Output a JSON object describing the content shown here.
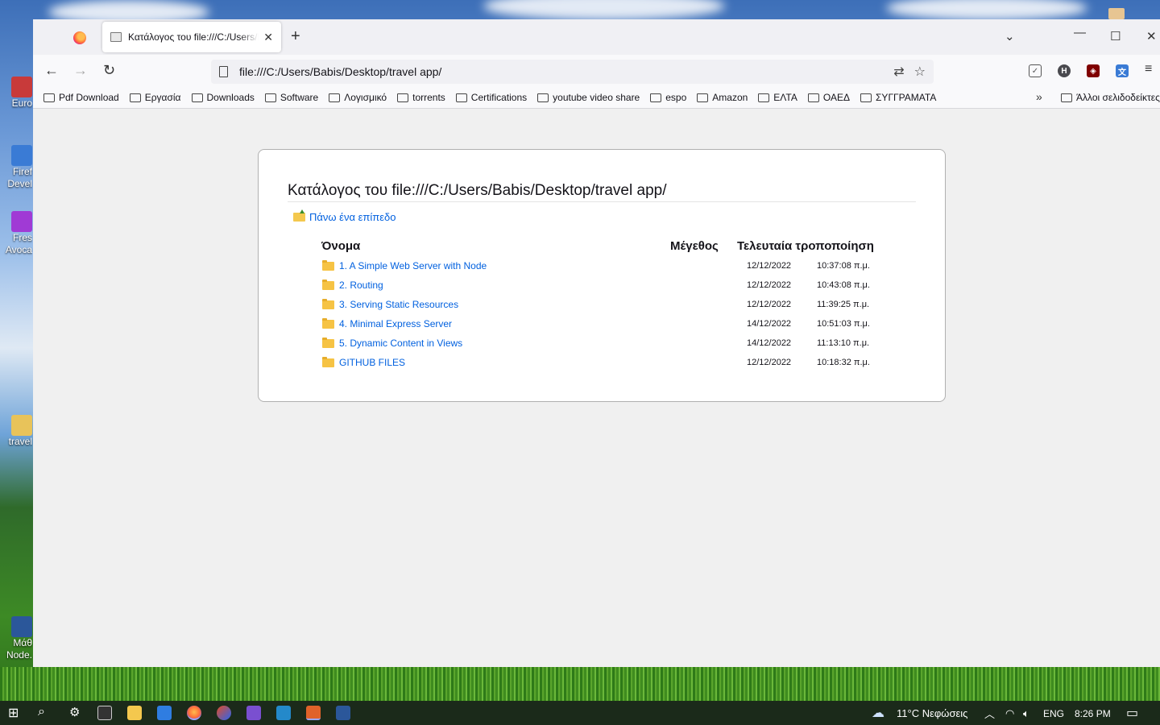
{
  "desktop": {
    "icons": [
      {
        "label": "Euro",
        "color": "#c83a3a"
      },
      {
        "label": "Firef Devel",
        "color": "#3a7bd5"
      },
      {
        "label": "Fres Avoca",
        "color": "#a03ad5"
      },
      {
        "label": "travel",
        "color": "#e8c35a"
      },
      {
        "label": "Μάθ Node.",
        "color": "#2b579a"
      }
    ]
  },
  "browser": {
    "tab": {
      "title": "Κατάλογος του file:///C:/Users/Babis/Desktop/travel app/"
    },
    "url": "file:///C:/Users/Babis/Desktop/travel app/",
    "bookmarks": [
      "Pdf Download",
      "Εργασία",
      "Downloads",
      "Software",
      "Λογισμικό",
      "torrents",
      "Certifications",
      "youtube video share",
      "espo",
      "Amazon",
      "ΕΛΤΑ",
      "ΟΑΕΔ",
      "ΣΥΓΓΡΑΜΑΤΑ"
    ],
    "other_bookmarks": "Άλλοι σελιδοδείκτες"
  },
  "listing": {
    "heading": "Κατάλογος του file:///C:/Users/Babis/Desktop/travel app/",
    "up_link": "Πάνω ένα επίπεδο",
    "columns": {
      "name": "Όνομα",
      "size": "Μέγεθος",
      "modified": "Τελευταία τροποποίηση"
    },
    "rows": [
      {
        "name": "1. A Simple Web Server with Node",
        "date": "12/12/2022",
        "time": "10:37:08 π.μ."
      },
      {
        "name": "2. Routing",
        "date": "12/12/2022",
        "time": "10:43:08 π.μ."
      },
      {
        "name": "3. Serving Static Resources",
        "date": "12/12/2022",
        "time": "11:39:25 π.μ."
      },
      {
        "name": "4. Minimal Express Server",
        "date": "14/12/2022",
        "time": "10:51:03 π.μ."
      },
      {
        "name": "5. Dynamic Content in Views",
        "date": "14/12/2022",
        "time": "11:13:10 π.μ."
      },
      {
        "name": "GITHUB FILES",
        "date": "12/12/2022",
        "time": "10:18:32 π.μ."
      }
    ]
  },
  "taskbar": {
    "weather": "11°C Νεφώσεις",
    "language": "ENG",
    "clock": "8:26 PM"
  },
  "colors": {
    "link": "#0060df",
    "folder": "#f6c344",
    "taskbar": "#1b2a1a"
  }
}
